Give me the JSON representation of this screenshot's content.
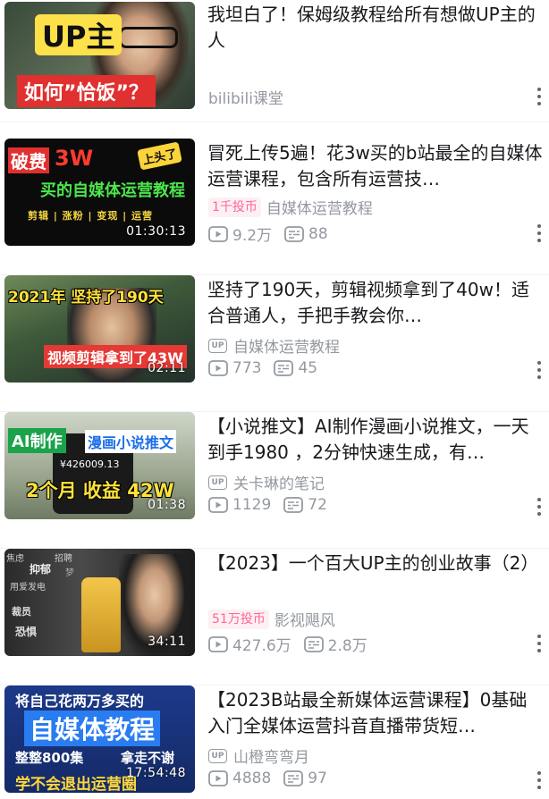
{
  "videos": [
    {
      "title": "我坦白了！保姆级教程给所有想做UP主的人",
      "author": "bilibili课堂",
      "duration": "",
      "thumb_lines": [
        "UP主",
        "如何”恰饭”？"
      ]
    },
    {
      "title": "冒死上传5遍！花3w买的b站最全的自媒体运营课程，包含所有运营技…",
      "coin_badge": "1千投币",
      "author": "自媒体运营教程",
      "views": "9.2万",
      "danmaku": "88",
      "duration": "01:30:13",
      "thumb_lines": [
        "破费",
        "3W",
        "上头了",
        "买的自媒体运营教程",
        "剪辑 | 涨粉 | 变现 | 运营"
      ]
    },
    {
      "title": "坚持了190天，剪辑视频拿到了40w！适合普通人，手把手教会你…",
      "author": "自媒体运营教程",
      "views": "773",
      "danmaku": "45",
      "duration": "02:11",
      "thumb_lines": [
        "2021年 坚持了190天",
        "视频剪辑拿到了43W"
      ]
    },
    {
      "title": "【小说推文】AI制作漫画小说推文，一天到手1980 ，2分钟快速生成，有…",
      "author": "关卡琳的笔记",
      "views": "1129",
      "danmaku": "72",
      "duration": "01:38",
      "thumb_lines": [
        "AI制作",
        "漫画小说推文",
        "¥426009.13",
        "2个月 收益 42W"
      ]
    },
    {
      "title": "【2023】一个百大UP主的创业故事（2）",
      "coin_badge": "51万投币",
      "author": "影视飓风",
      "views": "427.6万",
      "danmaku": "2.8万",
      "duration": "34:11",
      "thumb_lines": [
        "焦虑",
        "抑郁",
        "招聘",
        "梦",
        "用爱发电",
        "裁员",
        "恐惧"
      ]
    },
    {
      "title": "【2023B站最全新媒体运营课程】0基础入门全媒体运营抖音直播带货短…",
      "author": "山橙弯弯月",
      "views": "4888",
      "danmaku": "97",
      "duration": "17:54:48",
      "thumb_lines": [
        "将自己花两万多买的",
        "自媒体教程",
        "整整800集",
        "拿走不谢",
        "学不会退出运营圈"
      ]
    }
  ],
  "icons": {
    "play": "play-count-icon",
    "danmaku": "danmaku-count-icon",
    "uploader": "up-icon",
    "more": "more-icon"
  },
  "colors": {
    "coin_badge_text": "#ff6699",
    "coin_badge_bg": "#fdf0f3",
    "meta_text": "#9499a0"
  }
}
